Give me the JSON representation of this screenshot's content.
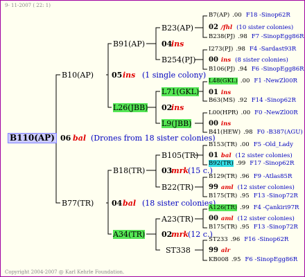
{
  "header": {
    "date": "9- 11-2007 ( 22: 1)"
  },
  "footer": {
    "copyright": "Copyright 2004-2007 @ Karl Kehrle Foundation."
  },
  "root": {
    "label": "B110(AP)",
    "gen": "06",
    "code": "bal",
    "note": "(Drones from 18 sister colonies)"
  },
  "l1": [
    {
      "label": "B10(AP)",
      "gen": "05",
      "code": "ins",
      "note": "(1 single colony)"
    },
    {
      "label": "B77(TR)",
      "gen": "04",
      "code": "bal",
      "note": "(18 sister colonies)"
    }
  ],
  "l2": [
    {
      "label": "B91(AP)"
    },
    {
      "label": "L26(JBB)"
    },
    {
      "label": "B18(TR)",
      "gen": "03",
      "code": "mrk",
      "note": "(15 c.)"
    },
    {
      "label": "A34(TR)",
      "gen": "02",
      "code": "mrk",
      "note": "(12 c.)"
    }
  ],
  "l3": [
    {
      "label": "B23(AP)"
    },
    {
      "label": "B254(PJ)"
    },
    {
      "label": "L71(GKL)"
    },
    {
      "label": "L9(JBB)"
    },
    {
      "label": "B105(TR)"
    },
    {
      "label": "B22(TR)"
    },
    {
      "label": "A23(TR)"
    },
    {
      "label": "ST338"
    }
  ],
  "l3_gen": [
    {
      "gen": "04",
      "code": "ins"
    },
    {
      "gen": "02",
      "code": "ins"
    },
    {
      "gen": "01",
      "code": "bal"
    },
    {
      "gen": "99",
      "code": "alr"
    }
  ],
  "l4": [
    {
      "a": "B7(AP)",
      "b": ".00",
      "c": "F18 -Sinop62R"
    },
    {
      "gen": "02",
      "code": "/fhl",
      "note": "(10 sister colonies)"
    },
    {
      "a": "B238(PJ)",
      "b": ".98",
      "c": "F7 -SinopEgg86R"
    },
    {
      "a": "I273(PJ)",
      "b": ".98",
      "c": "F4 -Sardast93R"
    },
    {
      "gen": "00",
      "code": "ins",
      "note": "(8 sister colonies)"
    },
    {
      "a": "B106(PJ)",
      "b": ".94",
      "c": "F6 -SinopEgg86R"
    },
    {
      "a": "L48(GKL)",
      "b": ".00",
      "c": "F1 -NewZl00R"
    },
    {
      "gen": "01",
      "code": "ins",
      "note": ""
    },
    {
      "a": "B63(MS)",
      "b": ".92",
      "c": "F14 -Sinop62R"
    },
    {
      "a": "L00(HPR)",
      "b": ".00",
      "c": "F0 -NewZl00R"
    },
    {
      "gen": "00",
      "code": "ins",
      "note": ""
    },
    {
      "a": "B41(HEW)",
      "b": ".98",
      "c": "F0 -B387(AGU)"
    },
    {
      "a": "B153(TR)",
      "b": ".00",
      "c": "F5 -Old_Lady"
    },
    {
      "gen": "01",
      "code": "bal",
      "note": "(12 sister colonies)"
    },
    {
      "a": "B92(TR)",
      "b": ".99",
      "c": "F17 -Sinop62R"
    },
    {
      "a": "B129(TR)",
      "b": ".96",
      "c": "F9 -Atlas85R"
    },
    {
      "gen": "99",
      "code": "aml",
      "note": "(12 sister colonies)"
    },
    {
      "a": "B175(TR)",
      "b": ".95",
      "c": "F13 -Sinop72R"
    },
    {
      "a": "A126(TR)",
      "b": ".99",
      "c": "F4 -Çankiri97R"
    },
    {
      "gen": "00",
      "code": "aml",
      "note": "(12 sister colonies)"
    },
    {
      "a": "B175(TR)",
      "b": ".95",
      "c": "F13 -Sinop72R"
    },
    {
      "a": "ST233",
      "b": ".96",
      "c": "F16 -Sinop62R"
    },
    {
      "gen": "99",
      "code": "alr",
      "note": ""
    },
    {
      "a": "KB008",
      "b": ".95",
      "c": "F6 -SinopEgg86R"
    }
  ]
}
